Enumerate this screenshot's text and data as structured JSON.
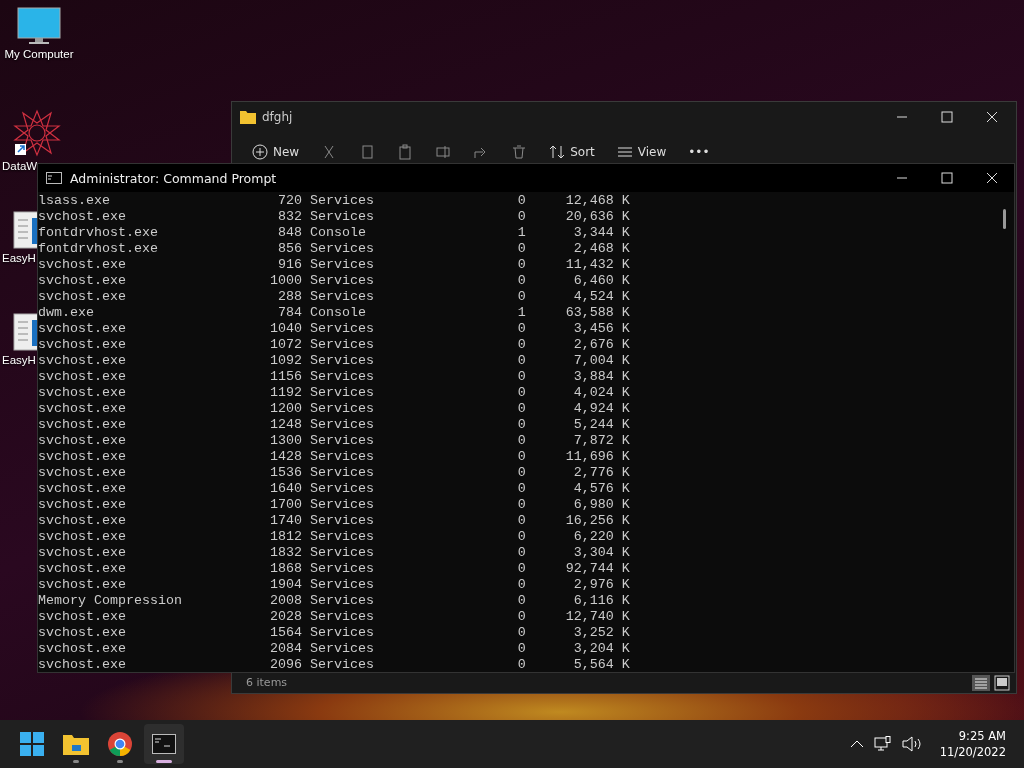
{
  "desktop_icons": [
    {
      "label": "My Computer",
      "kind": "monitor"
    },
    {
      "label": "DataW",
      "kind": "star"
    },
    {
      "label": "EasyH",
      "kind": "doc"
    },
    {
      "label": "EasyH",
      "kind": "doc"
    }
  ],
  "explorer": {
    "title": "dfghj",
    "toolbar": [
      {
        "label": "New",
        "kind": "new"
      },
      {
        "kind": "cut"
      },
      {
        "kind": "copy"
      },
      {
        "kind": "paste"
      },
      {
        "kind": "rename"
      },
      {
        "kind": "share"
      },
      {
        "kind": "delete"
      },
      {
        "label": "Sort",
        "kind": "sort"
      },
      {
        "label": "View",
        "kind": "view"
      },
      {
        "label": "•••",
        "kind": "more"
      }
    ],
    "status": "6 items"
  },
  "cmd": {
    "title": "Administrator: Command Prompt",
    "rows": [
      {
        "image": "lsass.exe",
        "pid": "720",
        "session": "Services",
        "session_num": "0",
        "mem": "12,468 K"
      },
      {
        "image": "svchost.exe",
        "pid": "832",
        "session": "Services",
        "session_num": "0",
        "mem": "20,636 K"
      },
      {
        "image": "fontdrvhost.exe",
        "pid": "848",
        "session": "Console",
        "session_num": "1",
        "mem": "3,344 K"
      },
      {
        "image": "fontdrvhost.exe",
        "pid": "856",
        "session": "Services",
        "session_num": "0",
        "mem": "2,468 K"
      },
      {
        "image": "svchost.exe",
        "pid": "916",
        "session": "Services",
        "session_num": "0",
        "mem": "11,432 K"
      },
      {
        "image": "svchost.exe",
        "pid": "1000",
        "session": "Services",
        "session_num": "0",
        "mem": "6,460 K"
      },
      {
        "image": "svchost.exe",
        "pid": "288",
        "session": "Services",
        "session_num": "0",
        "mem": "4,524 K"
      },
      {
        "image": "dwm.exe",
        "pid": "784",
        "session": "Console",
        "session_num": "1",
        "mem": "63,588 K"
      },
      {
        "image": "svchost.exe",
        "pid": "1040",
        "session": "Services",
        "session_num": "0",
        "mem": "3,456 K"
      },
      {
        "image": "svchost.exe",
        "pid": "1072",
        "session": "Services",
        "session_num": "0",
        "mem": "2,676 K"
      },
      {
        "image": "svchost.exe",
        "pid": "1092",
        "session": "Services",
        "session_num": "0",
        "mem": "7,004 K"
      },
      {
        "image": "svchost.exe",
        "pid": "1156",
        "session": "Services",
        "session_num": "0",
        "mem": "3,884 K"
      },
      {
        "image": "svchost.exe",
        "pid": "1192",
        "session": "Services",
        "session_num": "0",
        "mem": "4,024 K"
      },
      {
        "image": "svchost.exe",
        "pid": "1200",
        "session": "Services",
        "session_num": "0",
        "mem": "4,924 K"
      },
      {
        "image": "svchost.exe",
        "pid": "1248",
        "session": "Services",
        "session_num": "0",
        "mem": "5,244 K"
      },
      {
        "image": "svchost.exe",
        "pid": "1300",
        "session": "Services",
        "session_num": "0",
        "mem": "7,872 K"
      },
      {
        "image": "svchost.exe",
        "pid": "1428",
        "session": "Services",
        "session_num": "0",
        "mem": "11,696 K"
      },
      {
        "image": "svchost.exe",
        "pid": "1536",
        "session": "Services",
        "session_num": "0",
        "mem": "2,776 K"
      },
      {
        "image": "svchost.exe",
        "pid": "1640",
        "session": "Services",
        "session_num": "0",
        "mem": "4,576 K"
      },
      {
        "image": "svchost.exe",
        "pid": "1700",
        "session": "Services",
        "session_num": "0",
        "mem": "6,980 K"
      },
      {
        "image": "svchost.exe",
        "pid": "1740",
        "session": "Services",
        "session_num": "0",
        "mem": "16,256 K"
      },
      {
        "image": "svchost.exe",
        "pid": "1812",
        "session": "Services",
        "session_num": "0",
        "mem": "6,220 K"
      },
      {
        "image": "svchost.exe",
        "pid": "1832",
        "session": "Services",
        "session_num": "0",
        "mem": "3,304 K"
      },
      {
        "image": "svchost.exe",
        "pid": "1868",
        "session": "Services",
        "session_num": "0",
        "mem": "92,744 K"
      },
      {
        "image": "svchost.exe",
        "pid": "1904",
        "session": "Services",
        "session_num": "0",
        "mem": "2,976 K"
      },
      {
        "image": "Memory Compression",
        "pid": "2008",
        "session": "Services",
        "session_num": "0",
        "mem": "6,116 K"
      },
      {
        "image": "svchost.exe",
        "pid": "2028",
        "session": "Services",
        "session_num": "0",
        "mem": "12,740 K"
      },
      {
        "image": "svchost.exe",
        "pid": "1564",
        "session": "Services",
        "session_num": "0",
        "mem": "3,252 K"
      },
      {
        "image": "svchost.exe",
        "pid": "2084",
        "session": "Services",
        "session_num": "0",
        "mem": "3,204 K"
      },
      {
        "image": "svchost.exe",
        "pid": "2096",
        "session": "Services",
        "session_num": "0",
        "mem": "5,564 K"
      }
    ]
  },
  "taskbar": {
    "apps": [
      {
        "kind": "start",
        "selected": false
      },
      {
        "kind": "folder",
        "selected": false
      },
      {
        "kind": "browser",
        "selected": false
      },
      {
        "kind": "terminal",
        "selected": true
      }
    ],
    "time": "9:25 AM",
    "date": "11/20/2022"
  }
}
